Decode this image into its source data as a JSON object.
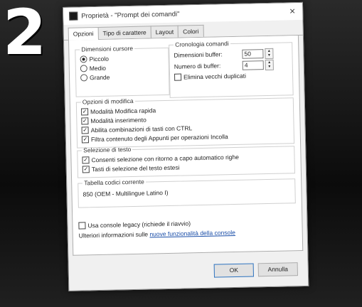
{
  "step_number": "2",
  "dialog": {
    "title": "Proprietà - \"Prompt dei comandi\"",
    "close_symbol": "×"
  },
  "tabs": [
    {
      "label": "Opzioni",
      "active": true
    },
    {
      "label": "Tipo di carattere",
      "active": false
    },
    {
      "label": "Layout",
      "active": false
    },
    {
      "label": "Colori",
      "active": false
    }
  ],
  "cursor_size": {
    "legend": "Dimensioni cursore",
    "options": [
      {
        "label": "Piccolo",
        "selected": true
      },
      {
        "label": "Medio",
        "selected": false
      },
      {
        "label": "Grande",
        "selected": false
      }
    ]
  },
  "command_history": {
    "legend": "Cronologia comandi",
    "buffer_size_label": "Dimensioni buffer:",
    "buffer_size_value": "50",
    "buffer_count_label": "Numero di buffer:",
    "buffer_count_value": "4",
    "discard_duplicates_label": "Elimina vecchi duplicati",
    "discard_duplicates_checked": false
  },
  "edit_options": {
    "legend": "Opzioni di modifica",
    "items": [
      {
        "label": "Modalità Modifica rapida",
        "checked": true
      },
      {
        "label": "Modalità inserimento",
        "checked": true
      },
      {
        "label": "Abilita combinazioni di tasti con CTRL",
        "checked": true
      },
      {
        "label": "Filtra contenuto degli Appunti per operazioni Incolla",
        "checked": true
      }
    ]
  },
  "text_selection": {
    "legend": "Selezione di testo",
    "items": [
      {
        "label": "Consenti selezione con ritorno a capo automatico righe",
        "checked": true
      },
      {
        "label": "Tasti di selezione del testo estesi",
        "checked": true
      }
    ]
  },
  "codepage": {
    "legend": "Tabella codici corrente",
    "value": "850  (OEM - Multilingue Latino I)"
  },
  "legacy_console": {
    "label": "Usa console legacy (richiede il riavvio)",
    "checked": false
  },
  "more_info": {
    "prefix": "Ulteriori informazioni sulle ",
    "link_text": "nuove funzionalità della console"
  },
  "buttons": {
    "ok": "OK",
    "cancel": "Annulla"
  }
}
